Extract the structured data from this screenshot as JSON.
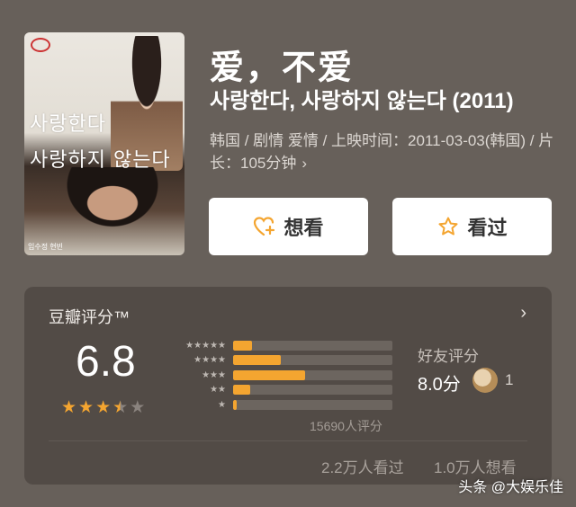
{
  "poster": {
    "title_line1": "사랑한다",
    "title_line2": "사랑하지 않는다",
    "credit": "임수정 현빈"
  },
  "movie": {
    "title_cn": "爱，不爱",
    "title_ko": "사랑한다, 사랑하지 않는다 (2011)",
    "meta": "韩国 / 剧情 爱情 / 上映时间：2011-03-03(韩国) / 片长：105分钟",
    "meta_chevron": "›"
  },
  "buttons": {
    "want_label": "想看",
    "seen_label": "看过"
  },
  "rating": {
    "title": "豆瓣评分™",
    "arrow": "›",
    "score": "6.8",
    "stars_value": 3.5,
    "distribution": [
      {
        "stars": "★★★★★",
        "fraction": 0.12
      },
      {
        "stars": "★★★★",
        "fraction": 0.3
      },
      {
        "stars": "★★★",
        "fraction": 0.45
      },
      {
        "stars": "★★",
        "fraction": 0.11
      },
      {
        "stars": "★",
        "fraction": 0.02
      }
    ],
    "count": "15690人评分",
    "friend_label": "好友评分",
    "friend_score": "8.0分",
    "friend_num": "1",
    "seen_count": "2.2万人看过",
    "want_count": "1.0万人想看"
  },
  "watermark": "头条 @大娱乐佳",
  "colors": {
    "accent": "#f4a530",
    "background": "#67605a",
    "card": "#524b46"
  }
}
